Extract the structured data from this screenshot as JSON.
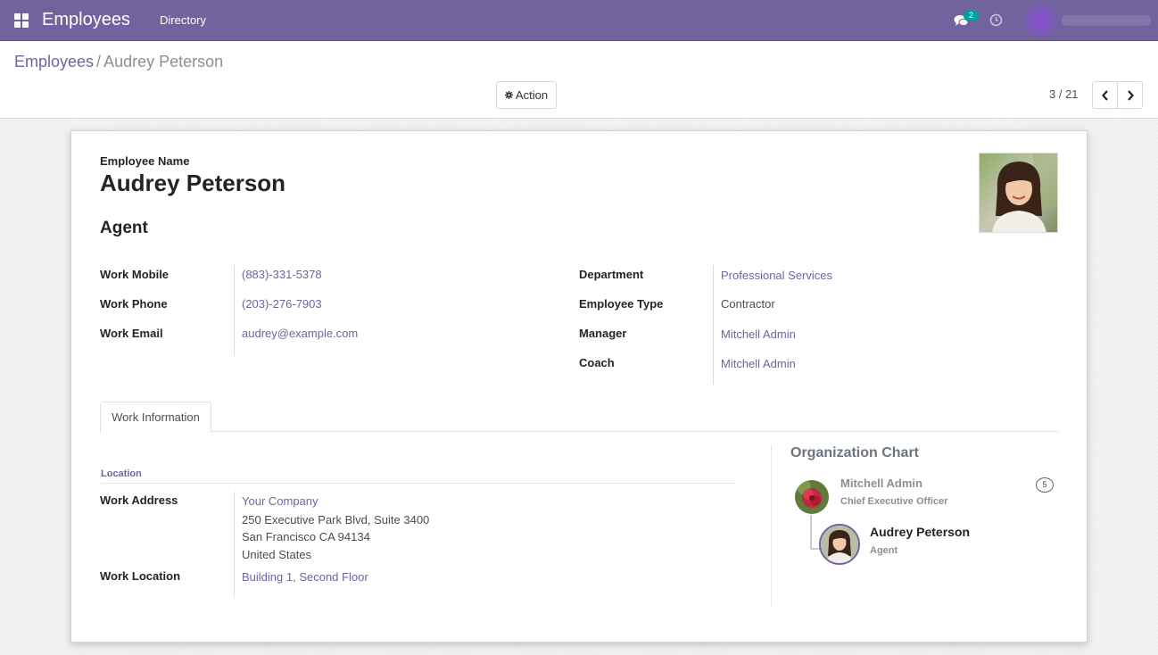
{
  "navbar": {
    "app_title": "Employees",
    "menu_directory": "Directory",
    "chat_badge_count": "2",
    "accent_color": "#71639e"
  },
  "breadcrumb": {
    "parent": "Employees",
    "separator": "/",
    "current": "Audrey Peterson"
  },
  "toolbar": {
    "action_label": "Action",
    "pager_value": "3 / 21"
  },
  "employee": {
    "name_label": "Employee Name",
    "name": "Audrey Peterson",
    "job_title": "Agent"
  },
  "fields_left": [
    {
      "label": "Work Mobile",
      "value": "(883)-331-5378"
    },
    {
      "label": "Work Phone",
      "value": "(203)-276-7903"
    },
    {
      "label": "Work Email",
      "value": "audrey@example.com"
    }
  ],
  "fields_right": [
    {
      "label": "Department",
      "value": "Professional Services"
    },
    {
      "label": "Employee Type",
      "value": "Contractor"
    },
    {
      "label": "Manager",
      "value": "Mitchell Admin"
    },
    {
      "label": "Coach",
      "value": "Mitchell Admin"
    }
  ],
  "tabs": {
    "work_information": "Work Information"
  },
  "work_info": {
    "section_title": "Location",
    "work_address_label": "Work Address",
    "address": {
      "company": "Your Company",
      "street": "250 Executive Park Blvd, Suite 3400",
      "city_line": "San Francisco CA 94134",
      "country": "United States"
    },
    "work_location_label": "Work Location",
    "work_location": "Building 1, Second Floor"
  },
  "org_chart": {
    "title": "Organization Chart",
    "manager_name": "Mitchell Admin",
    "manager_job": "Chief Executive Officer",
    "manager_subordinates": "5",
    "self_name": "Audrey Peterson",
    "self_job": "Agent"
  },
  "icons": {
    "apps": "apps-grid-icon",
    "chat": "chat-bubbles-icon",
    "activity": "clock-icon",
    "action": "gear-icon",
    "prev": "chevron-left-icon",
    "next": "chevron-right-icon"
  }
}
